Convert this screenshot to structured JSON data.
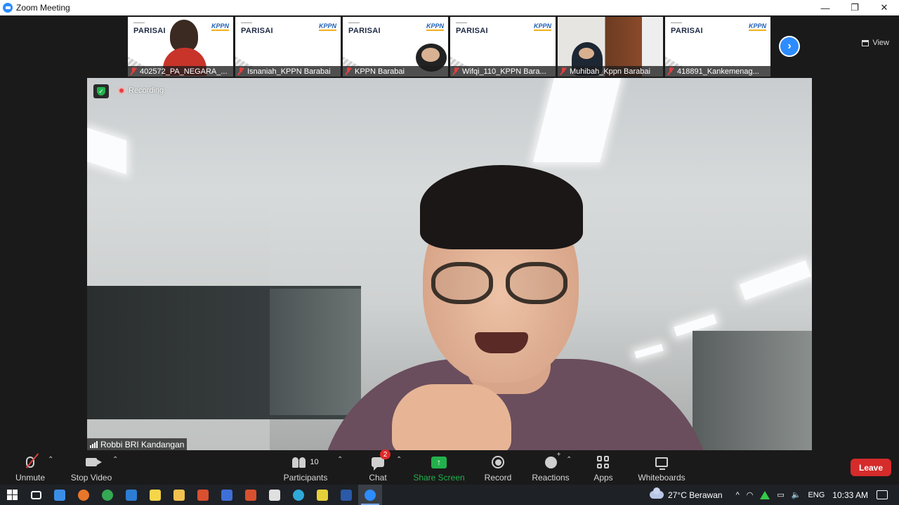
{
  "window": {
    "title": "Zoom Meeting",
    "controls": {
      "minimize": "—",
      "restore": "❐",
      "close": "✕"
    }
  },
  "gallery": {
    "view_label": "View",
    "tiles": [
      {
        "name": "402572_PA_NEGARA_...",
        "slide_title": "PARISAI",
        "logo": "KPPN",
        "muted": true,
        "has_person": true
      },
      {
        "name": "Isnaniah_KPPN Barabai",
        "slide_title": "PARISAI",
        "logo": "KPPN",
        "muted": true,
        "has_person": false
      },
      {
        "name": "KPPN Barabai",
        "slide_title": "PARISAI",
        "logo": "KPPN",
        "muted": true,
        "has_person": true
      },
      {
        "name": "Wifqi_110_KPPN Bara...",
        "slide_title": "PARISAI",
        "logo": "KPPN",
        "muted": true,
        "has_person": false
      },
      {
        "name": "Muhibah_Kppn Barabai",
        "slide_title": "PARISAI",
        "logo": "KPPN",
        "muted": true,
        "has_person": true
      },
      {
        "name": "418891_Kankemenag...",
        "slide_title": "PARISAI",
        "logo": "KPPN",
        "muted": true,
        "has_person": false
      }
    ],
    "next_icon": "chevron-right-icon"
  },
  "main_video": {
    "recording_label": "Recording",
    "speaker_name": "Robbi BRI Kandangan"
  },
  "toolbar": {
    "unmute": "Unmute",
    "stop_video": "Stop Video",
    "participants": "Participants",
    "participants_count": "10",
    "chat": "Chat",
    "chat_badge": "2",
    "share_screen": "Share Screen",
    "record": "Record",
    "reactions": "Reactions",
    "apps": "Apps",
    "whiteboards": "Whiteboards",
    "leave": "Leave"
  },
  "taskbar": {
    "weather": "27°C  Berawan",
    "language": "ENG",
    "time": "10:33 AM",
    "apps": [
      {
        "name": "task-view",
        "color": "#ffffff"
      },
      {
        "name": "store",
        "color": "#3a8ee6"
      },
      {
        "name": "firefox",
        "color": "#e8762b"
      },
      {
        "name": "chrome",
        "color": "#34a853"
      },
      {
        "name": "mail",
        "color": "#2d7dd2"
      },
      {
        "name": "sticky-notes",
        "color": "#f7d54a"
      },
      {
        "name": "file-explorer",
        "color": "#f2c14e"
      },
      {
        "name": "app-orange-1",
        "color": "#d9502e"
      },
      {
        "name": "app-blue",
        "color": "#3f6fd8"
      },
      {
        "name": "app-orange-2",
        "color": "#d9502e"
      },
      {
        "name": "app-bird",
        "color": "#e0e0e0"
      },
      {
        "name": "edge",
        "color": "#2fa9d8"
      },
      {
        "name": "app-yellow",
        "color": "#e6d13a"
      },
      {
        "name": "word",
        "color": "#2b5aa8"
      },
      {
        "name": "zoom",
        "color": "#2d8cff"
      }
    ]
  },
  "colors": {
    "accent": "#2d8cff",
    "share_green": "#22b14c",
    "leave_red": "#d52b2b",
    "muted_red": "#e14040"
  }
}
